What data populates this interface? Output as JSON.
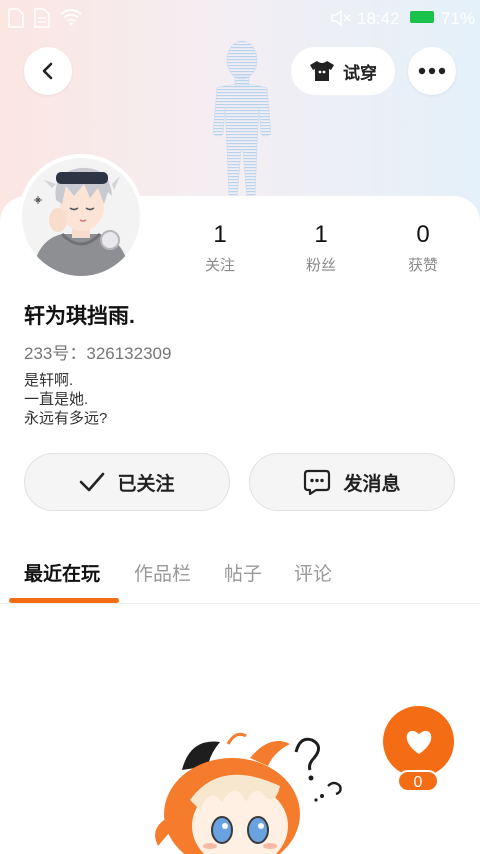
{
  "status_bar": {
    "time": "18:42",
    "battery": "71%",
    "icons": [
      "document-icon",
      "document-icon",
      "wifi-icon",
      "mute-icon",
      "battery-icon"
    ]
  },
  "header": {
    "back_icon": "chevron-left-icon",
    "try_on_label": "试穿",
    "try_on_icon": "tshirt-icon",
    "more_icon": "more-horizontal-icon"
  },
  "profile": {
    "stats": [
      {
        "value": "1",
        "label": "关注"
      },
      {
        "value": "1",
        "label": "粉丝"
      },
      {
        "value": "0",
        "label": "获赞"
      }
    ],
    "name": "轩为琪挡雨.",
    "id_text": "233号：326132309",
    "bio": [
      "是轩啊.",
      "一直是她.",
      "永远有多远?"
    ]
  },
  "actions": {
    "follow_label": "已关注",
    "message_label": "发消息"
  },
  "tabs": [
    {
      "label": "最近在玩",
      "active": true
    },
    {
      "label": "作品栏",
      "active": false
    },
    {
      "label": "帖子",
      "active": false
    },
    {
      "label": "评论",
      "active": false
    }
  ],
  "like": {
    "count": "0"
  },
  "colors": {
    "accent": "#f46c14",
    "battery": "#18c24b"
  }
}
